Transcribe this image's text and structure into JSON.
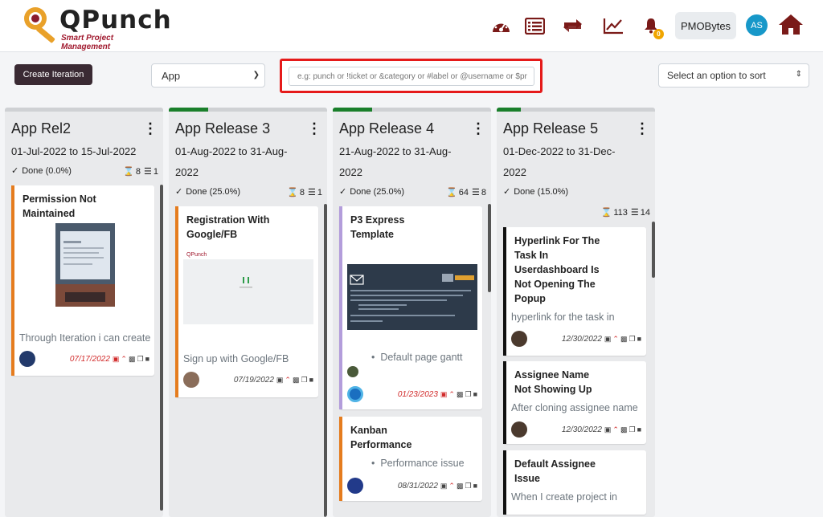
{
  "app": {
    "brand_title": "QPunch",
    "brand_subtitle": "Smart Project Management"
  },
  "header": {
    "icons": [
      "dashboard-icon",
      "list-icon",
      "sync-icon",
      "chart-icon",
      "bell-icon"
    ],
    "notification_count": "0",
    "workspace_label": "PMOBytes",
    "user_initials": "AS"
  },
  "toolbar": {
    "create_iteration_label": "Create Iteration",
    "app_select_value": "App",
    "search_placeholder": "e.g: punch or !ticket or &category or #label or @username or $pr",
    "sort_placeholder": "Select an option to sort"
  },
  "columns": [
    {
      "title": "App Rel2",
      "dates": "01-Jul-2022 to 15-Jul-2022",
      "done": "Done (0.0%)",
      "hours": "8",
      "tasks": "1",
      "progress": 0,
      "cards": [
        {
          "title_l1": "Permission Not",
          "title_l2": "Maintained",
          "desc": "Through Iteration i can create",
          "date": "07/17/2022",
          "date_overdue": true,
          "stripe": "#e57c1e"
        }
      ]
    },
    {
      "title": "App Release 3",
      "dates_l1": "01-Aug-2022 to 31-Aug-",
      "dates_l2": "2022",
      "done": "Done (25.0%)",
      "hours": "8",
      "tasks": "1",
      "progress": 0.25,
      "cards": [
        {
          "title_l1": "Registration With",
          "title_l2": "Google/FB",
          "desc": "Sign up with Google/FB",
          "date": "07/19/2022",
          "date_overdue": false,
          "stripe": "#e57c1e"
        }
      ]
    },
    {
      "title": "App Release 4",
      "dates_l1": "21-Aug-2022 to 31-Aug-",
      "dates_l2": "2022",
      "done": "Done (25.0%)",
      "hours": "64",
      "tasks": "8",
      "progress": 0.25,
      "cards": [
        {
          "title_l1": "P3 Express",
          "title_l2": "Template",
          "bullet": "Default page gantt",
          "date": "01/23/2023",
          "date_overdue": true,
          "stripe": "#b39ddb"
        },
        {
          "title_l1": "Kanban",
          "title_l2": "Performance",
          "bullet": "Performance issue",
          "date": "08/31/2022",
          "date_overdue": false,
          "stripe": "#e57c1e"
        }
      ]
    },
    {
      "title": "App Release 5",
      "dates_l1": "01-Dec-2022 to 31-Dec-",
      "dates_l2": "2022",
      "done": "Done (15.0%)",
      "hours": "113",
      "tasks": "14",
      "progress": 0.15,
      "cards": [
        {
          "title_l1": "Hyperlink For The",
          "title_l2": "Task In",
          "title_l3": "Userdashboard Is",
          "title_l4": "Not Opening The",
          "title_l5": "Popup",
          "desc": "hyperlink for the task in",
          "date": "12/30/2022",
          "date_overdue": false,
          "stripe": "#111"
        },
        {
          "title_l1": "Assignee Name",
          "title_l2": "Not Showing Up",
          "desc": "After cloning assignee name",
          "date": "12/30/2022",
          "date_overdue": false,
          "stripe": "#111"
        },
        {
          "title_l1": "Default Assignee",
          "title_l2": "Issue",
          "desc": "When I create project in",
          "stripe": "#111"
        }
      ]
    }
  ],
  "colors": {
    "brand_dark": "#7a1a18",
    "done_bar": "#1a7f2b",
    "search_highlight": "#e51a1a",
    "create_button": "#3a2a33"
  }
}
